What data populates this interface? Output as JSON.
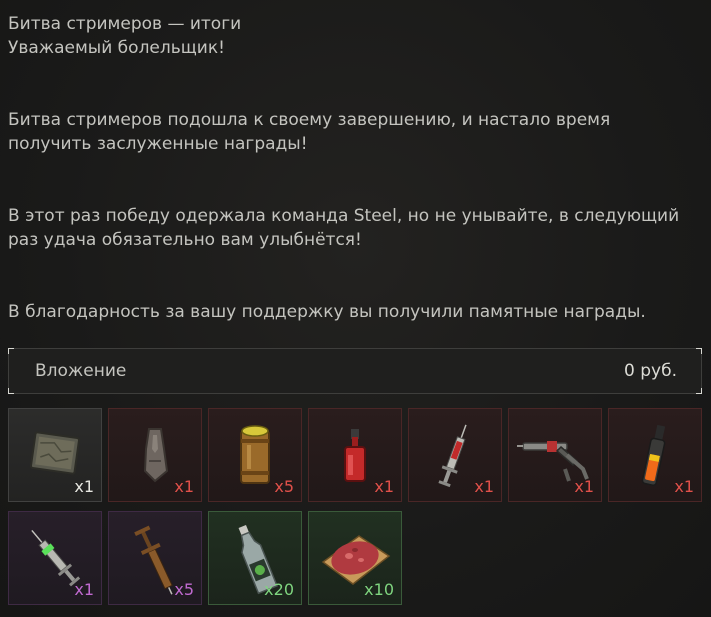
{
  "message": {
    "title": "Битва стримеров — итоги",
    "greeting": "Уважаемый болельщик!",
    "para1": "Битва стримеров подошла к своему завершению, и настало время получить заслуженные награды!",
    "para2": "В этот раз победу одержала команда Steel, но не унывайте, в следующий раз удача обязательно вам улыбнётся!",
    "para3": "В благодарность за вашу поддержку вы получили памятные награды."
  },
  "attachment": {
    "label": "Вложение",
    "value": "0  руб."
  },
  "colors": {
    "qty_gray": "#e6e6e0",
    "qty_red": "#e0504a",
    "qty_purple": "#c06ad0",
    "qty_green": "#7fd47f"
  },
  "items": [
    {
      "icon": "map-icon",
      "rarity": "gray",
      "qty": "x1"
    },
    {
      "icon": "charm-icon",
      "rarity": "red",
      "qty": "x1"
    },
    {
      "icon": "canister-icon",
      "rarity": "red",
      "qty": "x5"
    },
    {
      "icon": "red-bottle-icon",
      "rarity": "red",
      "qty": "x1"
    },
    {
      "icon": "red-syringe-icon",
      "rarity": "red",
      "qty": "x1"
    },
    {
      "icon": "injector-gun-icon",
      "rarity": "red",
      "qty": "x1"
    },
    {
      "icon": "orange-vial-icon",
      "rarity": "red",
      "qty": "x1"
    },
    {
      "icon": "green-syringe-icon",
      "rarity": "purple",
      "qty": "x1"
    },
    {
      "icon": "brown-syringe-icon",
      "rarity": "purple",
      "qty": "x5"
    },
    {
      "icon": "water-bottle-icon",
      "rarity": "green",
      "qty": "x20"
    },
    {
      "icon": "meat-sandwich-icon",
      "rarity": "green",
      "qty": "x10"
    }
  ]
}
